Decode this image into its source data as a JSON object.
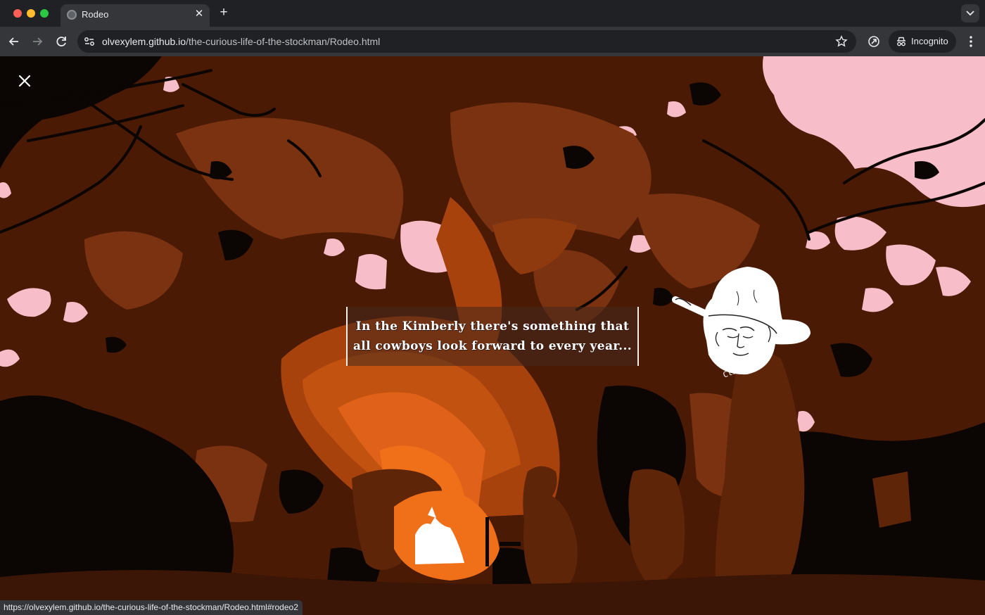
{
  "browser": {
    "tab_title": "Rodeo",
    "url_host": "olvexylem.github.io",
    "url_path": "/the-curious-life-of-the-stockman/Rodeo.html",
    "profile_label": "Incognito",
    "status_url": "https://olvexylem.github.io/the-curious-life-of-the-stockman/Rodeo.html#rodeo2"
  },
  "page": {
    "caption_line1": "In the Kimberly there's something that",
    "caption_line2": "all cowboys look forward to every year...",
    "cowboy_hint": "Click me!"
  },
  "colors": {
    "dark_brown": "#4a1a05",
    "black_shadow": "#0b0503",
    "mid_brown": "#7a3210",
    "orange": "#c2520f",
    "bright_orange": "#f0701a",
    "sky_pink": "#f7bdc9",
    "fire_white": "#ffffff"
  }
}
